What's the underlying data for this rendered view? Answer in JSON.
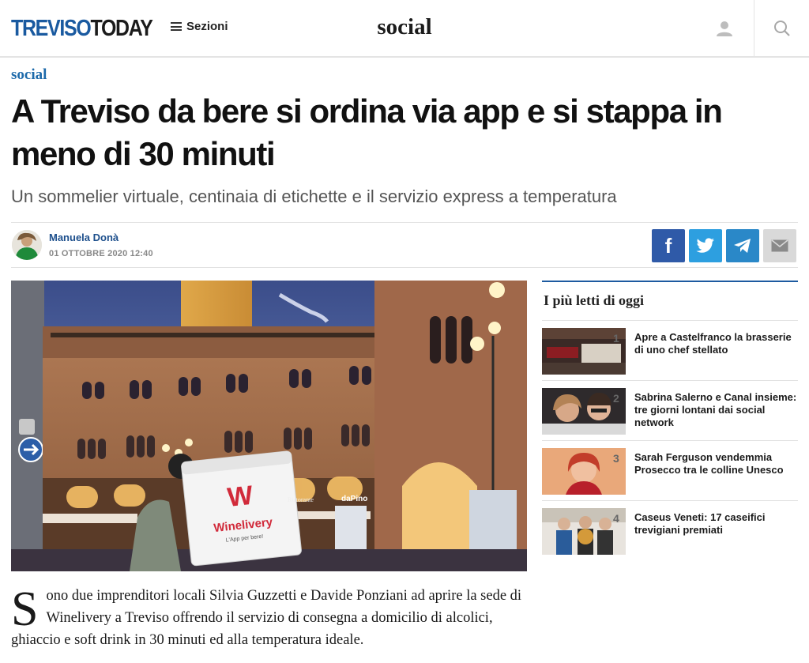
{
  "header": {
    "logo_part1": "TREVISO",
    "logo_part2": "TODAY",
    "menu_label": "Sezioni",
    "section": "social"
  },
  "article": {
    "kicker": "social",
    "headline": "A Treviso da bere si ordina via app e si stappa in meno di 30 minuti",
    "subheadline": "Un sommelier virtuale, centinaia di etichette e il servizio express a temperatura",
    "author": "Manuela Donà",
    "date": "01 OTTOBRE 2020 12:40",
    "dropcap": "S",
    "body": "ono due imprenditori locali Silvia Guzzetti e Davide Ponziani ad aprire la sede di Winelivery a Treviso offrendo il servizio di consegna a domicilio di alcolici, ghiaccio e soft drink in 30 minuti ed alla temperatura ideale.",
    "image_texts": {
      "box_brand": "Winelivery",
      "box_tagline": "L'App per bere!",
      "shop_sign": "daPino",
      "restaurant_sign": "Ristorante"
    }
  },
  "share": {
    "facebook": "f",
    "twitter": "twitter-icon",
    "telegram": "telegram-icon",
    "email": "email-icon"
  },
  "sidebar": {
    "title": "I più letti di oggi",
    "items": [
      {
        "num": "1",
        "title": "Apre a Castelfranco la brasserie di uno chef stellato"
      },
      {
        "num": "2",
        "title": "Sabrina Salerno e Canal insieme: tre giorni lontani dai social network"
      },
      {
        "num": "3",
        "title": "Sarah Ferguson vendemmia Prosecco tra le colline Unesco"
      },
      {
        "num": "4",
        "title": "Caseus Veneti: 17 caseifici trevigiani premiati"
      }
    ]
  },
  "colors": {
    "brand_blue": "#1a5aa0",
    "facebook": "#2f5aa8",
    "twitter": "#2d9fe0",
    "telegram": "#2a88c8",
    "email": "#d9d9d9"
  }
}
